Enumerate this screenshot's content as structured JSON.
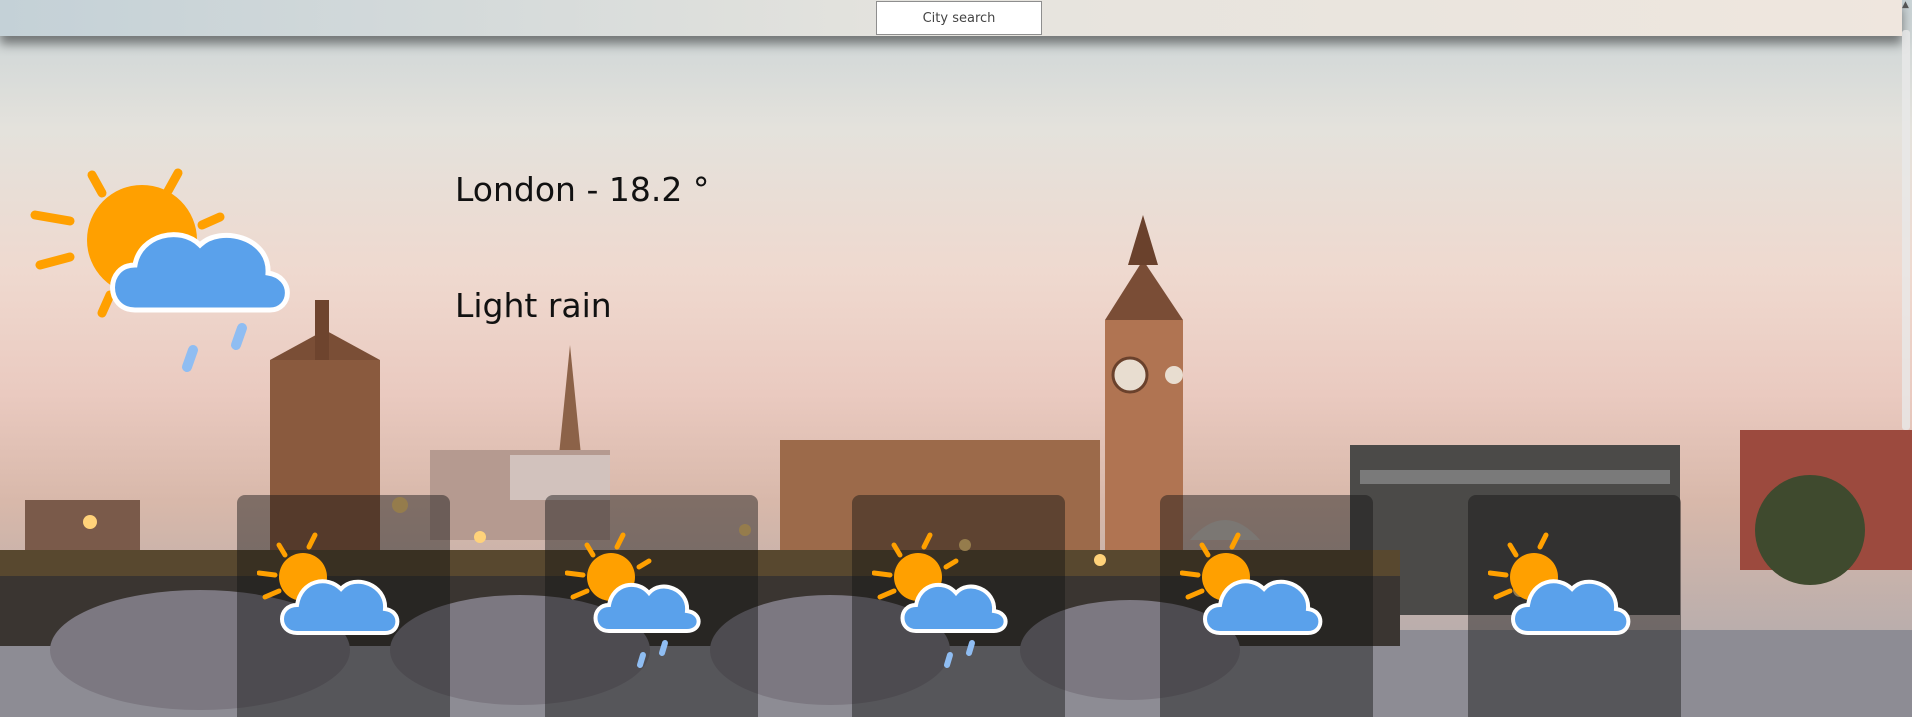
{
  "search": {
    "placeholder": "City search"
  },
  "current": {
    "city_temp": "London - 18.2 °",
    "description": "Light rain",
    "icon": "partly-cloudy-rain-icon"
  },
  "forecast": [
    {
      "icon": "partly-cloudy-icon"
    },
    {
      "icon": "partly-cloudy-rain-icon"
    },
    {
      "icon": "partly-cloudy-rain-icon"
    },
    {
      "icon": "partly-cloudy-icon"
    },
    {
      "icon": "partly-cloudy-icon"
    }
  ],
  "colors": {
    "sun": "#ffa000",
    "cloud": "#5aa1eb",
    "rain": "#8fbdf2"
  }
}
